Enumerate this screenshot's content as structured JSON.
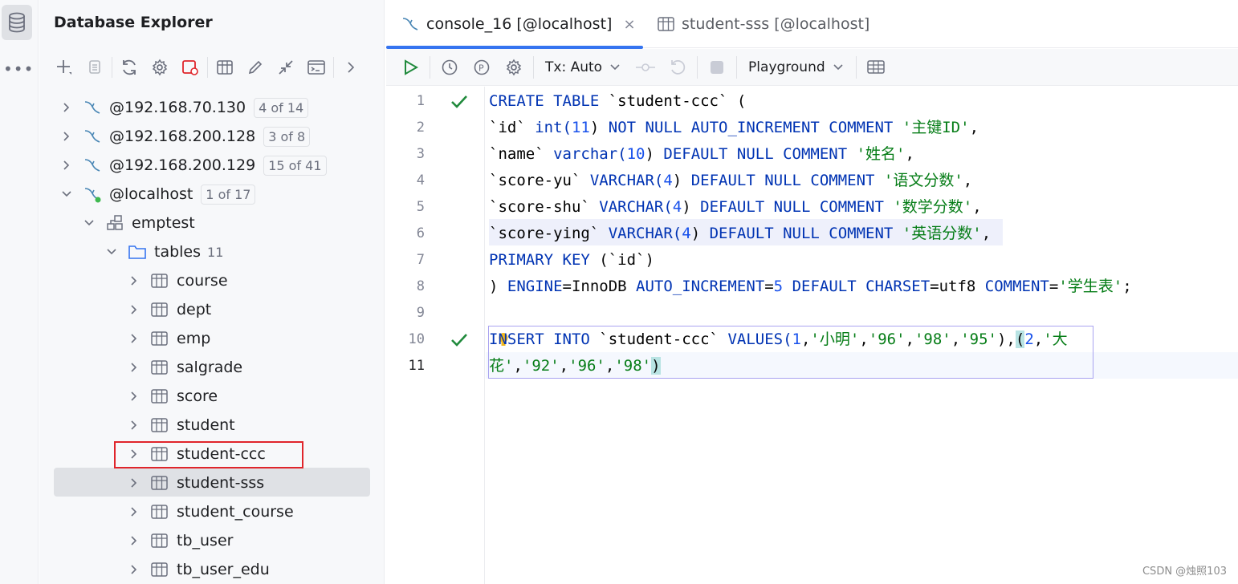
{
  "explorer": {
    "title": "Database Explorer",
    "toolbar": [
      "add-icon",
      "copy-icon",
      "refresh-icon",
      "settings-icon",
      "disconnect-icon",
      "table-icon",
      "edit-icon",
      "jump-icon",
      "console-icon",
      "more-icon"
    ]
  },
  "tree": {
    "connections": [
      {
        "label": "@192.168.70.130",
        "badge": "4 of 14"
      },
      {
        "label": "@192.168.200.128",
        "badge": "3 of 8"
      },
      {
        "label": "@192.168.200.129",
        "badge": "15 of 41"
      },
      {
        "label": "@localhost",
        "badge": "1 of 17"
      }
    ],
    "schema": "emptest",
    "folder": {
      "label": "tables",
      "count": "11"
    },
    "tables": [
      "course",
      "dept",
      "emp",
      "salgrade",
      "score",
      "student",
      "student-ccc",
      "student-sss",
      "student_course",
      "tb_user",
      "tb_user_edu"
    ],
    "selected_table": "student-sss",
    "highlighted_table": "student-ccc"
  },
  "tabs": [
    {
      "label": "console_16 [@localhost]",
      "active": true
    },
    {
      "label": "student-sss [@localhost]",
      "active": false
    }
  ],
  "editor_toolbar": {
    "tx_label": "Tx: Auto",
    "playground_label": "Playground"
  },
  "line_numbers": [
    "1",
    "2",
    "3",
    "4",
    "5",
    "6",
    "7",
    "8",
    "9",
    "10",
    "11"
  ],
  "code": {
    "l1": [
      "CREATE TABLE ",
      "`student-ccc`",
      " ("
    ],
    "l2": [
      "`id`",
      " int(",
      "11",
      ") ",
      "NOT NULL AUTO_INCREMENT COMMENT ",
      "'主键ID'",
      ","
    ],
    "l3": [
      "`name`",
      " varchar(",
      "10",
      ") ",
      "DEFAULT NULL COMMENT ",
      "'姓名'",
      ","
    ],
    "l4": [
      "`score-yu`",
      " VARCHAR(",
      "4",
      ") ",
      "DEFAULT NULL COMMENT ",
      "'语文分数'",
      ","
    ],
    "l5": [
      "`score-shu`",
      " VARCHAR(",
      "4",
      ") ",
      "DEFAULT NULL COMMENT ",
      "'数学分数'",
      ","
    ],
    "l6": [
      "`score-ying`",
      " VARCHAR(",
      "4",
      ") ",
      "DEFAULT NULL COMMENT ",
      "'英语分数'",
      ","
    ],
    "l7": [
      "PRIMARY KEY ",
      "(`id`)"
    ],
    "l8": [
      ") ",
      "ENGINE",
      "=InnoDB ",
      "AUTO_INCREMENT",
      "=",
      "5",
      " ",
      "DEFAULT CHARSET",
      "=utf8 ",
      "COMMENT",
      "=",
      "'学生表'",
      ";"
    ],
    "l10": [
      "INSERT INTO ",
      "`student-ccc`",
      " VALUES(",
      "1",
      ",",
      "'小明'",
      ",",
      "'96'",
      ",",
      "'98'",
      ",",
      "'95'",
      "),",
      "(",
      "2",
      ",",
      "'大"
    ],
    "l11": [
      "花'",
      ",",
      "'92'",
      ",",
      "'96'",
      ",",
      "'98'",
      ")"
    ]
  },
  "watermark": "CSDN @烛照103",
  "colors": {
    "accent": "#3574f0",
    "keyword": "#0033b3",
    "string": "#067d17",
    "number": "#1750eb",
    "check": "#208a3c",
    "highlight_box": "#e0252b"
  }
}
